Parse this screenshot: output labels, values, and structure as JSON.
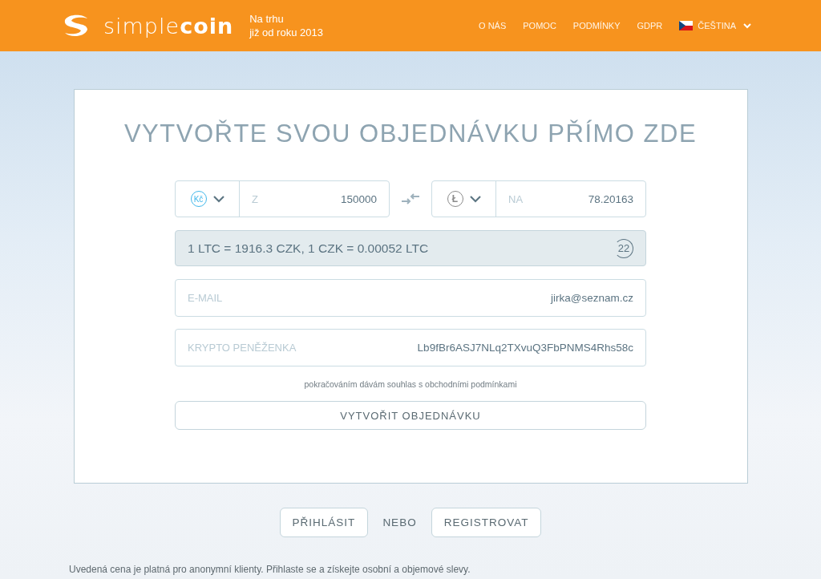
{
  "header": {
    "logo": {
      "light": "simple",
      "bold": "coin"
    },
    "tagline": [
      "Na trhu",
      "již od roku 2013"
    ],
    "nav": [
      {
        "label": "O NÁS"
      },
      {
        "label": "POMOC"
      },
      {
        "label": "PODMÍNKY"
      },
      {
        "label": "GDPR"
      }
    ],
    "language": "ČEŠTINA"
  },
  "form": {
    "title": "VYTVOŘTE SVOU OBJEDNÁVKU PŘÍMO ZDE",
    "from": {
      "currency_symbol": "Kč",
      "label": "Z",
      "value": "150000"
    },
    "to": {
      "currency_symbol": "Ł",
      "label": "NA",
      "value": "78.20163"
    },
    "rate": "1 LTC = 1916.3 CZK, 1 CZK = 0.00052 LTC",
    "countdown": "22",
    "fields": [
      {
        "label": "E-MAIL",
        "value": "jirka@seznam.cz"
      },
      {
        "label": "KRYPTO PENĚŽENKA",
        "value": "Lb9fBr6ASJ7NLq2TXvuQ3FbPNMS4Rhs58c"
      }
    ],
    "consent": "pokračováním dávám souhlas s obchodními podmínkami",
    "submit": "VYTVOŘIT OBJEDNÁVKU"
  },
  "auth": {
    "login": "PŘIHLÁSIT",
    "or": "NEBO",
    "register": "REGISTROVAT"
  },
  "footnote": "Uvedená cena je platná pro anonymní klienty. Přihlaste se a získejte osobní a objemové slevy."
}
